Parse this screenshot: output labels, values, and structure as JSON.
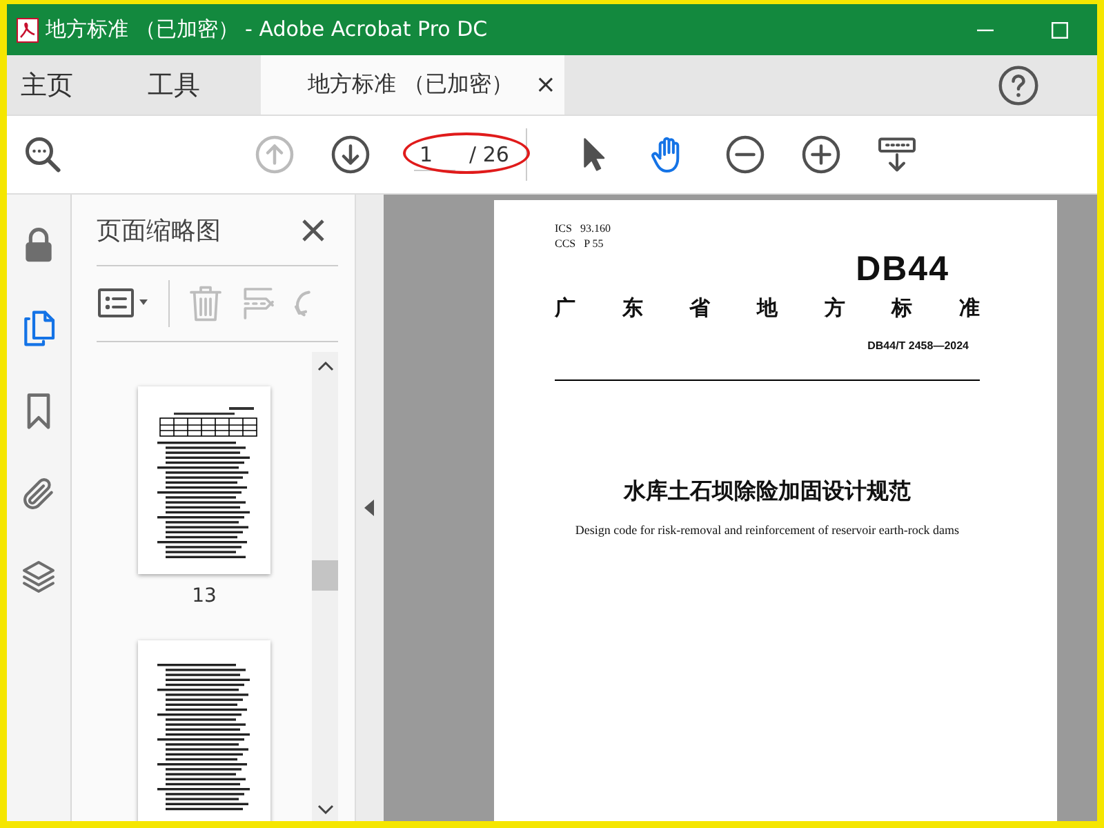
{
  "window": {
    "title": "地方标准 （已加密） - Adobe Acrobat Pro DC"
  },
  "nav_tabs": [
    {
      "label": "主页",
      "selected": false
    },
    {
      "label": "工具",
      "selected": false
    },
    {
      "label": "地方标准 （已加密）",
      "selected": true,
      "close": "×"
    }
  ],
  "toolbar": {
    "left_tools": [
      {
        "kind": "find",
        "disabled": false
      }
    ],
    "nav_tools": [
      {
        "kind": "prev-page",
        "disabled": true
      },
      {
        "kind": "next-page",
        "disabled": false
      }
    ],
    "page_field": {
      "value": "1",
      "total": "/ 26"
    },
    "right_tools": [
      {
        "kind": "select",
        "selected": false
      },
      {
        "kind": "hand",
        "selected": true
      },
      {
        "kind": "zoom-out",
        "selected": false
      },
      {
        "kind": "zoom-in",
        "selected": false
      },
      {
        "kind": "keyboard",
        "selected": false
      }
    ]
  },
  "rail": [
    {
      "kind": "lock",
      "selected": false
    },
    {
      "kind": "pages",
      "selected": true
    },
    {
      "kind": "bookmark",
      "selected": false
    },
    {
      "kind": "attachment",
      "selected": false
    },
    {
      "kind": "layers",
      "selected": false
    }
  ],
  "panel": {
    "title": "页面缩略图",
    "tools": [
      {
        "kind": "options",
        "disabled": false
      },
      {
        "kind": "delete",
        "disabled": true
      },
      {
        "kind": "extract",
        "disabled": true
      },
      {
        "kind": "rotate",
        "disabled": true
      }
    ],
    "thumbnails": [
      {
        "kind": "table-page",
        "label": "13"
      },
      {
        "kind": "text-page"
      }
    ]
  },
  "document": {
    "codes": [
      {
        "scheme": "ICS",
        "value": "93.160"
      },
      {
        "scheme": "CCS",
        "value": "P 55"
      }
    ],
    "logo": "DB44",
    "issuer": "广东省地方标准",
    "number": "DB44/T 2458—2024",
    "title": "水库土石坝除险加固设计规范",
    "subtitle": "Design code for risk-removal and reinforcement of reservoir earth-rock dams"
  }
}
